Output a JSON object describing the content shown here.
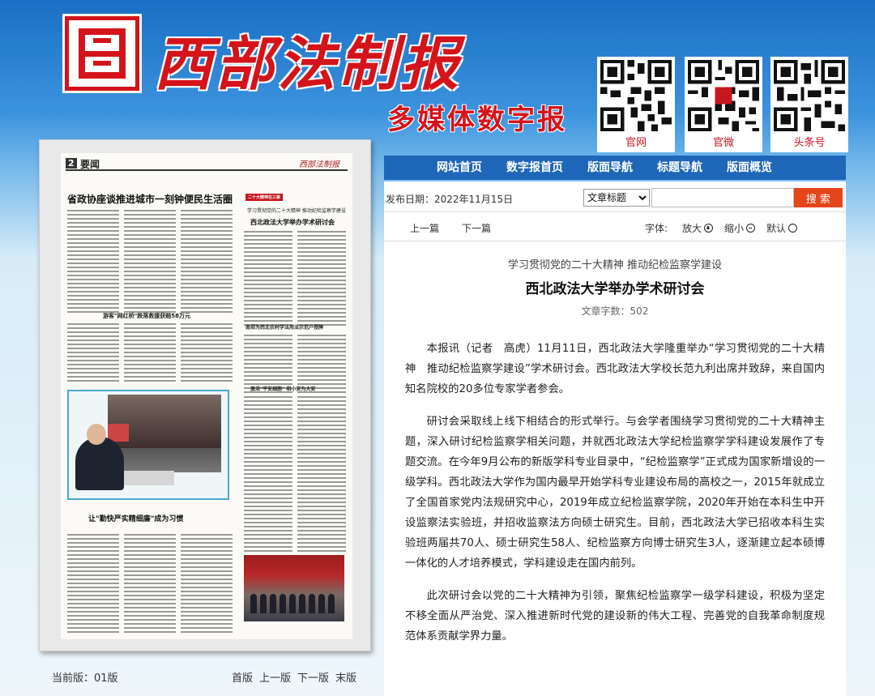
{
  "header": {
    "brand_name": "西部法制报",
    "brand_sub": "多媒体数字报",
    "qr_codes": [
      {
        "label": "官网"
      },
      {
        "label": "官微"
      },
      {
        "label": "头条号"
      }
    ]
  },
  "nav": {
    "items": [
      "网站首页",
      "数字报首页",
      "版面导航",
      "标题导航",
      "版面概览"
    ]
  },
  "newspaper_page": {
    "page_number": "2",
    "section": "要闻",
    "masthead_logo": "西部法制报",
    "headlines": [
      "省政协座谈推进城市一刻钟便民生活圈",
      "二十大精神在三秦",
      "学习贯彻党的二十大精神 推动纪检监察学建设",
      "西北政法大学举办学术研讨会",
      "游客\"网红桥\"跌落救援获赔58万元",
      "南郑为西北农村学法用法示范户授牌",
      "激活\"平安细胞\" 和小安为大安",
      "让\"勤快严实精细廉\"成为习惯"
    ],
    "footer_current": "当前版：01版",
    "footer_nav": [
      "首版",
      "上一版",
      "下一版",
      "末版"
    ]
  },
  "article_panel": {
    "pub_date": "发布日期：2022年11月15日",
    "search_select": "文章标题",
    "search_placeholder": "",
    "search_button": "搜 索",
    "prev": "上一篇",
    "next": "下一篇",
    "font_label": "字体:",
    "font_larger": "放大",
    "font_smaller": "缩小",
    "font_default": "默认",
    "supertitle": "学习贯彻党的二十大精神 推动纪检监察学建设",
    "title": "西北政法大学举办学术研讨会",
    "wordcount": "文章字数：502",
    "paragraphs": [
      "本报讯（记者　高虎）11月11日，西北政法大学隆重举办“学习贯彻党的二十大精神　推动纪检监察学建设”学术研讨会。西北政法大学校长范九利出席并致辞，来自国内知名院校的20多位专家学者参会。",
      "研讨会采取线上线下相结合的形式举行。与会学者围绕学习贯彻党的二十大精神主题，深入研讨纪检监察学相关问题，并就西北政法大学纪检监察学学科建设发展作了专题交流。在今年9月公布的新版学科专业目录中，“纪检监察学”正式成为国家新增设的一级学科。西北政法大学作为国内最早开始学科专业建设布局的高校之一，2015年就成立了全国首家党内法规研究中心，2019年成立纪检监察学院，2020年开始在本科生中开设监察法实验班，并招收监察法方向硕士研究生。目前，西北政法大学已招收本科生实验班两届共70人、硕士研究生58人、纪检监察方向博士研究生3人，逐渐建立起本硕博一体化的人才培养模式，学科建设走在国内前列。",
      "此次研讨会以党的二十大精神为引领，聚焦纪检监察学一级学科建设，积极为坚定不移全面从严治党、深入推进新时代党的建设新的伟大工程、完善党的自我革命制度规范体系贡献学界力量。"
    ]
  },
  "colors": {
    "brand_red": "#d4141a",
    "nav_blue": "#1e66b8",
    "search_orange": "#e4461a"
  }
}
